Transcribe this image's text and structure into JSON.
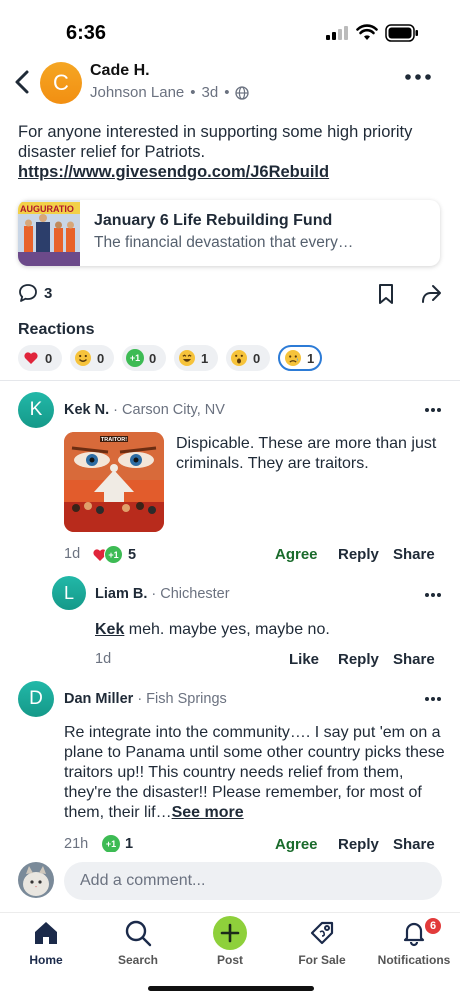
{
  "status_bar": {
    "time": "6:36"
  },
  "post": {
    "author": "Cade H.",
    "avatar_letter": "C",
    "neighborhood": "Johnson Lane",
    "age": "3d",
    "text": "For anyone interested in supporting some high priority disaster relief for Patriots.",
    "link": "https://www.givesendgo.com/J6Rebuild",
    "link_card": {
      "title": "January 6 Life Rebuilding Fund",
      "description": "The financial devastation that every…"
    },
    "comment_count": "3"
  },
  "reactions": {
    "title": "Reactions",
    "items": [
      {
        "name": "heart",
        "emoji": "❤️",
        "count": "0"
      },
      {
        "name": "smile",
        "emoji": "🙂",
        "count": "0"
      },
      {
        "name": "plus-one",
        "emoji": "+1",
        "count": "0"
      },
      {
        "name": "laugh",
        "emoji": "😄",
        "count": "1"
      },
      {
        "name": "wow",
        "emoji": "😮",
        "count": "0"
      },
      {
        "name": "sad",
        "emoji": "😥",
        "count": "1",
        "active": true
      }
    ]
  },
  "comments": [
    {
      "author": "Kek N.",
      "avatar_letter": "K",
      "location": "· Carson City, NV",
      "image_caption": "TRAITOR!",
      "text": "Dispicable. These are more than just criminals. They are traitors.",
      "age": "1d",
      "reaction_count": "5",
      "actions": {
        "agree": "Agree",
        "reply": "Reply",
        "share": "Share"
      }
    },
    {
      "author": "Liam B.",
      "avatar_letter": "L",
      "location": "· Chichester",
      "mention": "Kek",
      "text": " meh. maybe yes, maybe no.",
      "age": "1d",
      "actions": {
        "like": "Like",
        "reply": "Reply",
        "share": "Share"
      }
    },
    {
      "author": "Dan Miller",
      "avatar_letter": "D",
      "location": "· Fish Springs",
      "text": "Re integrate into the community…. I say put 'em on a plane to Panama until some other country picks these traitors up!! This country needs relief from them, they're the disaster!! Please remember, for most of them, their lif…",
      "see_more": "See more",
      "age": "21h",
      "reaction_count": "1",
      "actions": {
        "agree": "Agree",
        "reply": "Reply",
        "share": "Share"
      }
    }
  ],
  "comment_box": {
    "placeholder": "Add a comment..."
  },
  "nav": {
    "items": [
      {
        "label": "Home",
        "icon": "home-icon"
      },
      {
        "label": "Search",
        "icon": "search-icon"
      },
      {
        "label": "Post",
        "icon": "plus-icon"
      },
      {
        "label": "For Sale",
        "icon": "tag-icon"
      },
      {
        "label": "Notifications",
        "icon": "bell-icon"
      }
    ],
    "notifications_badge": "6"
  },
  "colors": {
    "accent": "#8ed03b",
    "agree": "#1a6b2c",
    "avatar_teal": "#1aa899",
    "avatar_orange": "#f5a623",
    "badge": "#e23b3b"
  }
}
